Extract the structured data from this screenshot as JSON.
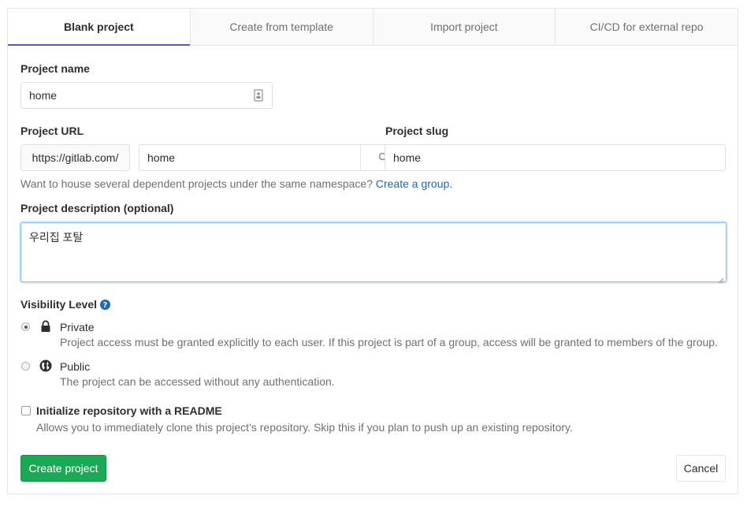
{
  "tabs": [
    {
      "label": "Blank project",
      "active": true
    },
    {
      "label": "Create from template",
      "active": false
    },
    {
      "label": "Import project",
      "active": false
    },
    {
      "label": "CI/CD for external repo",
      "active": false
    }
  ],
  "project_name": {
    "label": "Project name",
    "value": "home",
    "icon": "contact-card-icon"
  },
  "project_url": {
    "label": "Project URL",
    "prefix": "https://gitlab.com/",
    "namespace_value": "home",
    "icon": "search-icon"
  },
  "project_slug": {
    "label": "Project slug",
    "value": "home"
  },
  "namespace_help": {
    "text": "Want to house several dependent projects under the same namespace?",
    "link": "Create a group."
  },
  "description": {
    "label": "Project description (optional)",
    "value": "우리집 포탈"
  },
  "visibility": {
    "label": "Visibility Level",
    "help_icon": "question-circle-icon",
    "options": [
      {
        "title": "Private",
        "icon": "lock-icon",
        "description": "Project access must be granted explicitly to each user. If this project is part of a group, access will be granted to members of the group.",
        "checked": true
      },
      {
        "title": "Public",
        "icon": "globe-icon",
        "description": "The project can be accessed without any authentication.",
        "checked": false
      }
    ]
  },
  "readme": {
    "label": "Initialize repository with a README",
    "description": "Allows you to immediately clone this project’s repository. Skip this if you plan to push up an existing repository.",
    "checked": false
  },
  "actions": {
    "create_label": "Create project",
    "cancel_label": "Cancel"
  },
  "colors": {
    "accent_tab": "#6b4fbb",
    "success": "#1aaa55",
    "link": "#1b69b6"
  }
}
